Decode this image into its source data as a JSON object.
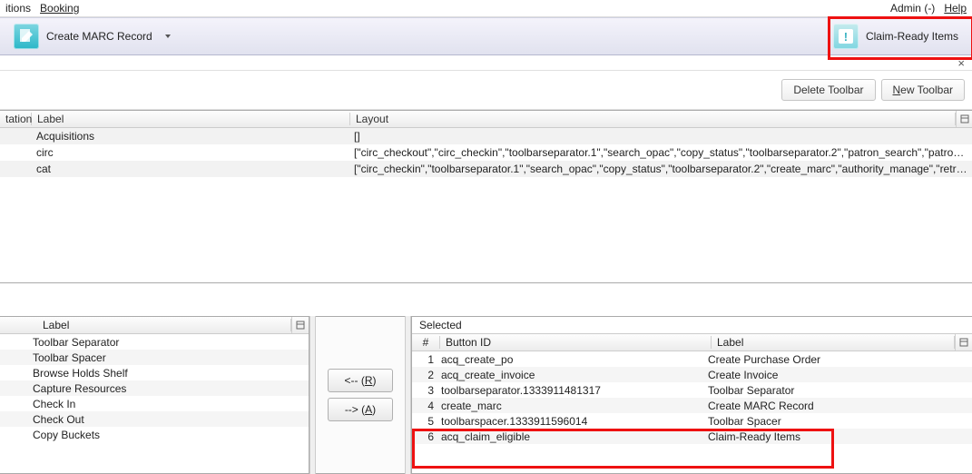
{
  "menu": {
    "left": [
      "itions",
      "Booking"
    ],
    "right": [
      "Admin (-)",
      "Help"
    ]
  },
  "toolbar": {
    "create_marc": "Create MARC Record",
    "claim_ready": "Claim-Ready Items"
  },
  "close_x": "×",
  "buttons": {
    "delete_toolbar": "Delete Toolbar",
    "new_toolbar_pre": "",
    "new_toolbar_u": "N",
    "new_toolbar_post": "ew Toolbar"
  },
  "top_grid": {
    "headers": {
      "c0": "tation",
      "c1": "Label",
      "c2": "Layout"
    },
    "rows": [
      {
        "label": "Acquisitions",
        "layout": "[]"
      },
      {
        "label": "circ",
        "layout": "[\"circ_checkout\",\"circ_checkin\",\"toolbarseparator.1\",\"search_opac\",\"copy_status\",\"toolbarseparator.2\",\"patron_search\",\"patron…"
      },
      {
        "label": "cat",
        "layout": "[\"circ_checkin\",\"toolbarseparator.1\",\"search_opac\",\"copy_status\",\"toolbarseparator.2\",\"create_marc\",\"authority_manage\",\"retri…"
      }
    ]
  },
  "left_panel": {
    "header": "Label",
    "rows": [
      "Toolbar Separator",
      "Toolbar Spacer",
      "Browse Holds Shelf",
      "Capture Resources",
      "Check In",
      "Check Out",
      "Copy Buckets"
    ]
  },
  "move": {
    "remove_pre": "<-- (",
    "remove_u": "R",
    "remove_post": ")",
    "add_pre": "--> (",
    "add_u": "A",
    "add_post": ")"
  },
  "right_panel": {
    "title": "Selected",
    "headers": {
      "num": "#",
      "id": "Button ID",
      "label": "Label"
    },
    "rows": [
      {
        "n": "1",
        "id": "acq_create_po",
        "label": "Create Purchase Order"
      },
      {
        "n": "2",
        "id": "acq_create_invoice",
        "label": "Create Invoice"
      },
      {
        "n": "3",
        "id": "toolbarseparator.1333911481317",
        "label": "Toolbar Separator"
      },
      {
        "n": "4",
        "id": "create_marc",
        "label": "Create MARC Record"
      },
      {
        "n": "5",
        "id": "toolbarspacer.1333911596014",
        "label": "Toolbar Spacer"
      },
      {
        "n": "6",
        "id": "acq_claim_eligible",
        "label": "Claim-Ready Items"
      }
    ]
  }
}
